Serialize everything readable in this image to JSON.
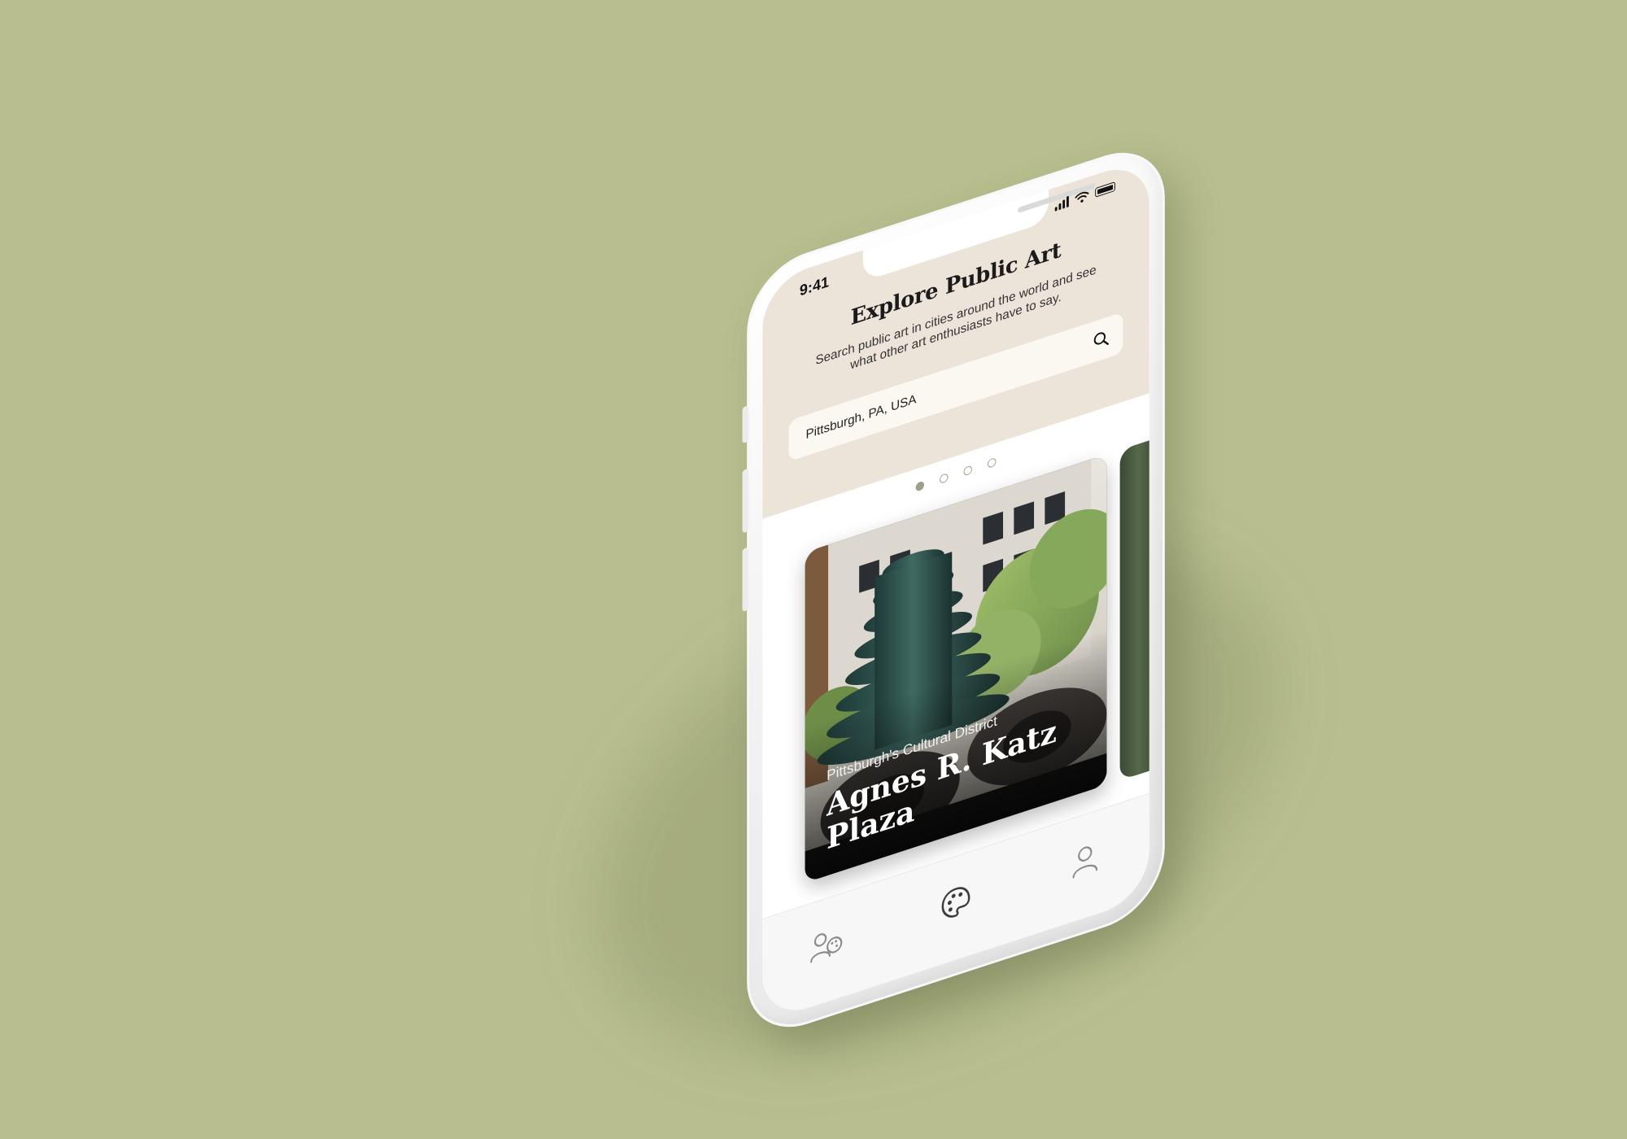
{
  "status_bar": {
    "time": "9:41"
  },
  "header": {
    "title": "Explore Public Art",
    "subtitle": "Search public art in cities around the world and see what other art enthusiasts have to say."
  },
  "search": {
    "value": "Pittsburgh, PA, USA",
    "icon": "search-icon"
  },
  "carousel": {
    "page_count": 4,
    "active_index": 0,
    "cards": [
      {
        "district": "Pittsburgh's Cultural District",
        "name": "Agnes R. Katz Plaza"
      }
    ]
  },
  "tabbar": {
    "tabs": [
      {
        "icon": "community-icon",
        "active": false
      },
      {
        "icon": "palette-icon",
        "active": true
      },
      {
        "icon": "profile-icon",
        "active": false
      }
    ]
  },
  "colors": {
    "background": "#b8be8e",
    "header": "#ece4d9",
    "accent": "#9aa08a",
    "icon_active": "#3c3c3c",
    "icon_inactive": "#8a8a8a"
  }
}
